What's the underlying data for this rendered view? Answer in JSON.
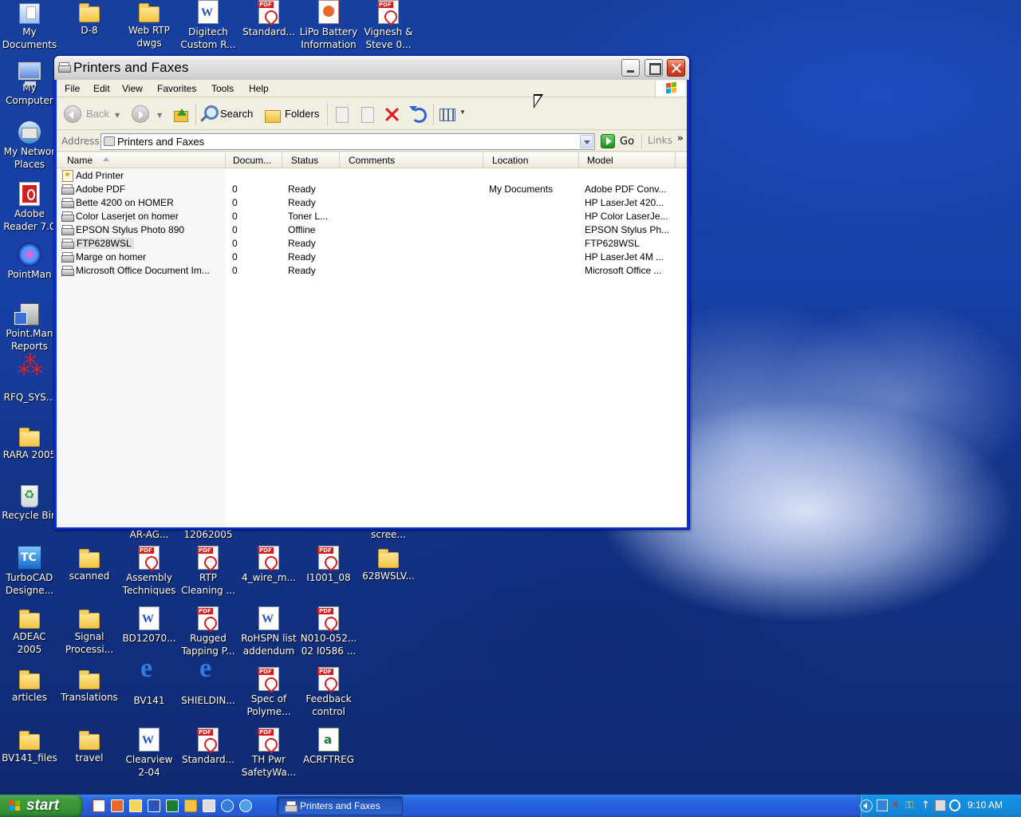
{
  "desktop": {
    "icons_top": [
      {
        "label": "My\nDocuments",
        "icon": "my-documents-icon"
      },
      {
        "label": "D-8",
        "icon": "folder-icon"
      },
      {
        "label": "Web RTP\ndwgs",
        "icon": "folder-icon"
      },
      {
        "label": "Digitech\nCustom R...",
        "icon": "word-doc-icon"
      },
      {
        "label": "Standard...",
        "icon": "pdf-icon"
      },
      {
        "label": "LiPo Battery\nInformation",
        "icon": "powerpoint-icon"
      },
      {
        "label": "Vignesh &\nSteve 0...",
        "icon": "pdf-icon"
      }
    ],
    "icons_left": [
      {
        "label": "My\nComputer",
        "icon": "my-computer-icon"
      },
      {
        "label": "My Networ\nPlaces",
        "icon": "network-places-icon"
      },
      {
        "label": "Adobe\nReader 7.0",
        "icon": "adobe-reader-icon"
      },
      {
        "label": "PointMan",
        "icon": "pointman-icon"
      },
      {
        "label": "Point.Man\nReports",
        "icon": "pointman-reports-icon"
      },
      {
        "label": "RFQ_SYS...",
        "icon": "rfq-sys-icon"
      },
      {
        "label": "RARA 2005",
        "icon": "folder-icon"
      },
      {
        "label": "Recycle Bin",
        "icon": "recycle-bin-icon"
      }
    ],
    "partial_labels": [
      "AR-AG...",
      "12062005",
      "scree..."
    ],
    "icons_row1": [
      {
        "label": "TurboCAD\nDesigne...",
        "icon": "turbocad-icon"
      },
      {
        "label": "scanned",
        "icon": "folder-icon"
      },
      {
        "label": "Assembly\nTechniques",
        "icon": "pdf-icon"
      },
      {
        "label": "RTP\nCleaning ...",
        "icon": "pdf-icon"
      },
      {
        "label": "4_wire_m...",
        "icon": "pdf-icon"
      },
      {
        "label": "I1001_08",
        "icon": "pdf-icon"
      },
      {
        "label": "628WSLV...",
        "icon": "folder-icon"
      }
    ],
    "icons_row2": [
      {
        "label": "ADEAC 2005",
        "icon": "folder-icon"
      },
      {
        "label": "Signal\nProcessi...",
        "icon": "folder-icon"
      },
      {
        "label": "BD12070...",
        "icon": "word-doc-icon"
      },
      {
        "label": "Rugged\nTapping P...",
        "icon": "pdf-icon"
      },
      {
        "label": "RoHSPN list\naddendum 1",
        "icon": "word-doc-icon"
      },
      {
        "label": "N010-052...\n02 I0586 ...",
        "icon": "pdf-icon"
      }
    ],
    "icons_row3": [
      {
        "label": "articles",
        "icon": "folder-icon"
      },
      {
        "label": "Translations",
        "icon": "folder-icon"
      },
      {
        "label": "BV141",
        "icon": "internet-explorer-icon"
      },
      {
        "label": "SHIELDIN...",
        "icon": "internet-explorer-icon"
      },
      {
        "label": "Spec  of\nPolyme...",
        "icon": "pdf-icon"
      },
      {
        "label": "Feedback\ncontrol",
        "icon": "pdf-icon"
      }
    ],
    "icons_row4": [
      {
        "label": "BV141_files",
        "icon": "folder-icon"
      },
      {
        "label": "travel",
        "icon": "folder-icon"
      },
      {
        "label": "Clearview\n2-04",
        "icon": "word-doc-icon"
      },
      {
        "label": "Standard...",
        "icon": "pdf-icon"
      },
      {
        "label": "TH Pwr\nSafetyWa...",
        "icon": "pdf-icon"
      },
      {
        "label": "ACRFTREG",
        "icon": "excel-icon"
      }
    ]
  },
  "window": {
    "title": "Printers and Faxes",
    "menu": [
      "File",
      "Edit",
      "View",
      "Favorites",
      "Tools",
      "Help"
    ],
    "toolbar": {
      "back_label": "Back",
      "search_label": "Search",
      "folders_label": "Folders"
    },
    "address": {
      "label": "Address",
      "value": "Printers and Faxes",
      "go_label": "Go",
      "links_label": "Links",
      "links_chevron": "»"
    },
    "columns": [
      "Name",
      "Docum...",
      "Status",
      "Comments",
      "Location",
      "Model"
    ],
    "rows": [
      {
        "name": "Add Printer",
        "docs": "",
        "status": "",
        "comments": "",
        "location": "",
        "model": "",
        "icon": "add-printer-icon"
      },
      {
        "name": "Adobe PDF",
        "docs": "0",
        "status": "Ready",
        "comments": "",
        "location": "My Documents",
        "model": "Adobe PDF Conv...",
        "icon": "printer-icon"
      },
      {
        "name": "Bette 4200 on HOMER",
        "docs": "0",
        "status": "Ready",
        "comments": "",
        "location": "",
        "model": "HP LaserJet 420...",
        "icon": "printer-icon"
      },
      {
        "name": "Color Laserjet on homer",
        "docs": "0",
        "status": "Toner L...",
        "comments": "",
        "location": "",
        "model": "HP Color LaserJe...",
        "icon": "printer-icon"
      },
      {
        "name": "EPSON Stylus Photo 890",
        "docs": "0",
        "status": "Offline",
        "comments": "",
        "location": "",
        "model": "EPSON Stylus Ph...",
        "icon": "printer-icon"
      },
      {
        "name": "FTP628WSL",
        "docs": "0",
        "status": "Ready",
        "comments": "",
        "location": "",
        "model": "FTP628WSL",
        "icon": "printer-icon",
        "selected": true
      },
      {
        "name": "Marge on homer",
        "docs": "0",
        "status": "Ready",
        "comments": "",
        "location": "",
        "model": "HP LaserJet 4M ...",
        "icon": "printer-icon"
      },
      {
        "name": "Microsoft Office Document Im...",
        "docs": "0",
        "status": "Ready",
        "comments": "",
        "location": "",
        "model": "Microsoft Office ...",
        "icon": "printer-icon"
      }
    ]
  },
  "taskbar": {
    "start_label": "start",
    "task_label": "Printers and Faxes",
    "clock": "9:10 AM"
  }
}
